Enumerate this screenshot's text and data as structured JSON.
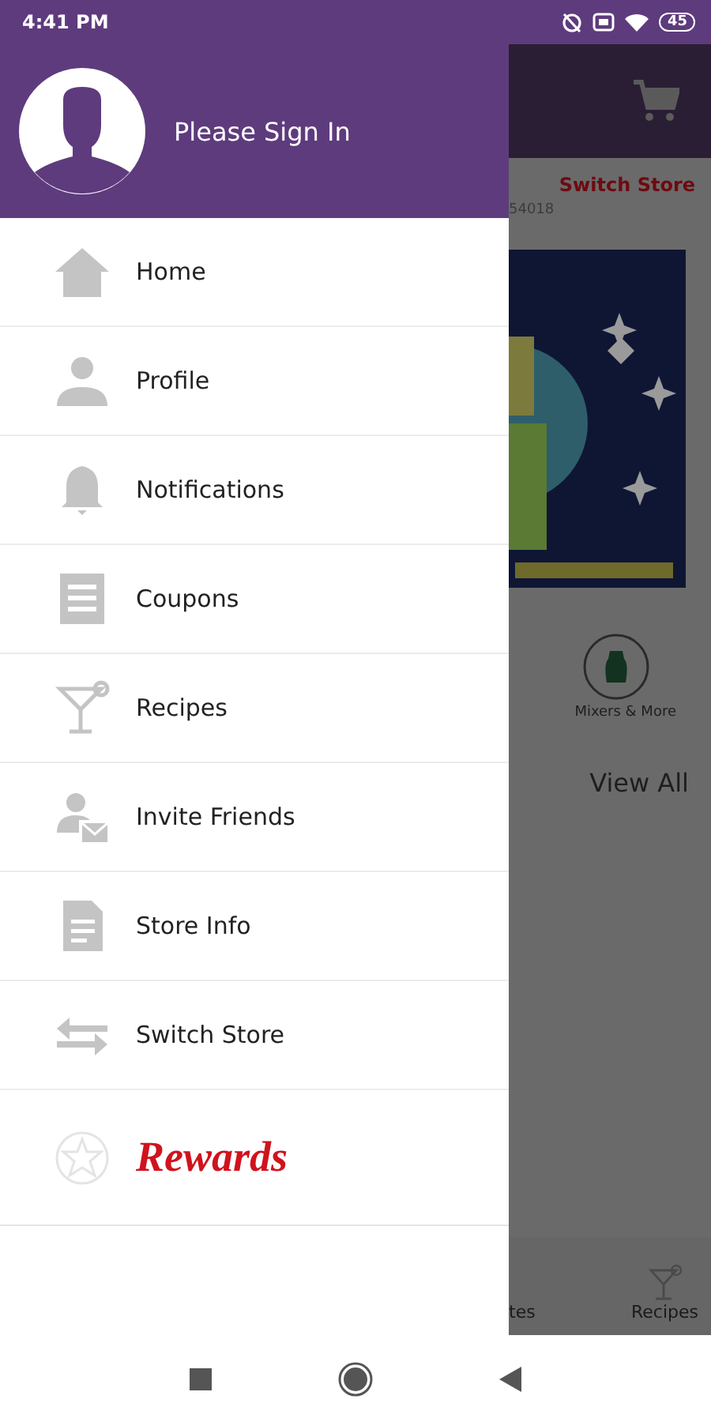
{
  "status_bar": {
    "time": "4:41 PM",
    "battery": "45"
  },
  "drawer": {
    "header": {
      "title": "Please Sign In"
    },
    "items": [
      {
        "label": "Home",
        "kind": "link"
      },
      {
        "label": "Profile",
        "kind": "link"
      },
      {
        "label": "Notifications",
        "kind": "link"
      },
      {
        "label": "Coupons",
        "kind": "link"
      },
      {
        "label": "Recipes",
        "kind": "link"
      },
      {
        "label": "Invite Friends",
        "kind": "link"
      },
      {
        "label": "Store Info",
        "kind": "link"
      },
      {
        "label": "Switch Store",
        "kind": "link"
      },
      {
        "label": "Rewards",
        "kind": "rewards"
      }
    ]
  },
  "background_screen": {
    "switch_store": "Switch Store",
    "store_code": "54018",
    "category": "Mixers & More",
    "view_all": "View All",
    "bottom_nav": [
      {
        "label": "tes"
      },
      {
        "label": "Recipes"
      }
    ]
  }
}
